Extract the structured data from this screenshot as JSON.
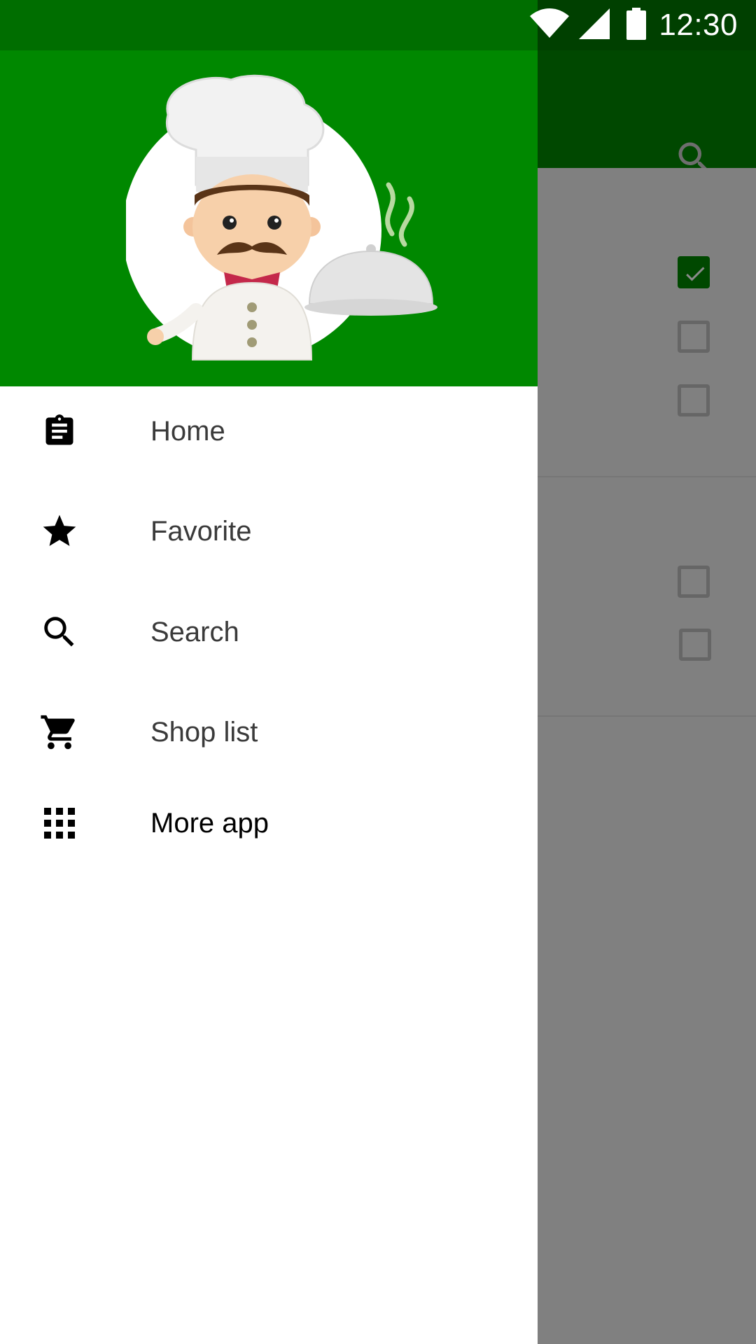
{
  "status_bar": {
    "time": "12:30",
    "icons": [
      "wifi-icon",
      "cellular-signal-icon",
      "battery-icon"
    ]
  },
  "drawer": {
    "header_image": "chef-logo",
    "items": [
      {
        "label": "Home",
        "icon": "clipboard-icon"
      },
      {
        "label": "Favorite",
        "icon": "star-icon"
      },
      {
        "label": "Search",
        "icon": "search-icon"
      },
      {
        "label": "Shop list",
        "icon": "cart-icon"
      },
      {
        "label": "More app",
        "icon": "apps-grid-icon"
      }
    ]
  },
  "background_app": {
    "toolbar_icon": "search-icon",
    "checkboxes": [
      {
        "checked": true
      },
      {
        "checked": false
      },
      {
        "checked": false
      },
      {
        "checked": false
      },
      {
        "checked": false
      }
    ]
  },
  "colors": {
    "drawer_header": "#008800",
    "status_bar": "#006e00",
    "toolbar_dimmed": "#004800",
    "scrim": "#808080"
  }
}
